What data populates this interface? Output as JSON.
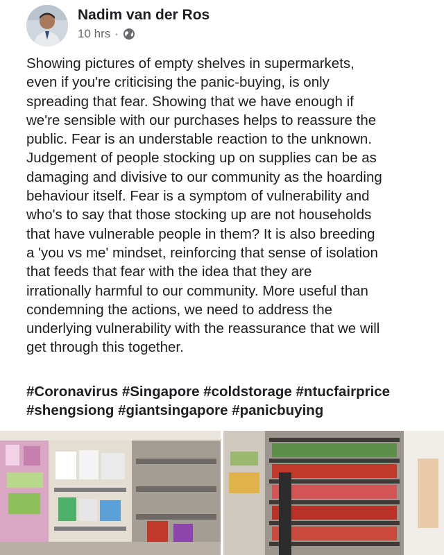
{
  "post": {
    "author": "Nadim van der Ros",
    "time": "10 hrs",
    "separator": "·",
    "privacy_icon": "globe-icon",
    "text": "Showing pictures of empty shelves in supermarkets,\neven if you're criticising the panic-buying, is only\nspreading that fear. Showing that we have enough if\nwe're sensible with our purchases helps to reassure the\npublic. Fear is an understable reaction to the unknown.\nJudgement of people stocking up on supplies can be as\ndamaging and divisive to our community as the hoarding\nbehaviour itself. Fear is a symptom of vulnerability and\nwho's to say that those stocking up are not households\nthat have vulnerable people in them? It is also breeding\na 'you vs me' mindset, reinforcing that sense of isolation\nthat feeds that fear with the idea that they are\nirrationally harmful to our community. More useful than\ncondemning the actions, we need to address the\nunderlying vulnerability with the reassurance that we will\nget through this together.",
    "hashtags": [
      "#Coronavirus",
      "#Singapore",
      "#coldstorage",
      "#ntucfairprice",
      "#shengsiong",
      "#giantsingapore",
      "#panicbuying"
    ]
  },
  "colors": {
    "text": "#1c1e21",
    "meta": "#65676b",
    "background": "#ffffff"
  }
}
